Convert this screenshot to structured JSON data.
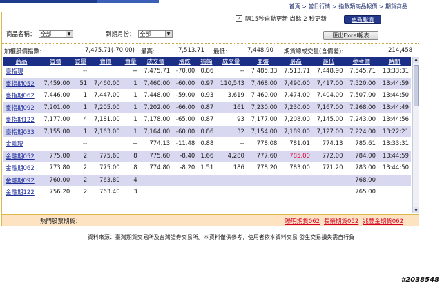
{
  "breadcrumb": [
    "首頁",
    "當日行情",
    "指數類商品報價",
    "期貨商品"
  ],
  "auto_refresh": {
    "label": "隔15秒自動更新 尚餘 2 秒更新",
    "checked": true
  },
  "buttons": {
    "refresh": "更新報價",
    "excel": "匯出Excel報表"
  },
  "filters": {
    "product_label": "商品名稱：",
    "product_value": "全部",
    "month_label": "到期月份：",
    "month_value": "全部"
  },
  "index_row": {
    "label": "加權股價指數:",
    "value": "7,475.71(-70.00)",
    "high_label": "最高:",
    "high": "7,513.71",
    "low_label": "最低:",
    "low": "7,448.90",
    "volume_label": "期貨總成交量(含價差):",
    "volume": "214,458"
  },
  "table": {
    "headers": [
      "商品",
      "買價",
      "買量",
      "賣價",
      "賣量",
      "成交價",
      "漲跌",
      "振幅",
      "成交量",
      "開盤",
      "最高",
      "最低",
      "參考價",
      "時間"
    ],
    "rows": [
      [
        "臺指現",
        "",
        "--",
        "",
        "--",
        "7,475.71",
        "-70.00",
        "0.86",
        "--",
        "7,485.33",
        "7,513.71",
        "7,448.90",
        "7,545.71",
        "13:33:31"
      ],
      [
        "臺指期052",
        "7,459.00",
        "51",
        "7,460.00",
        "1",
        "7,460.00",
        "-60.00",
        "0.97",
        "110,543",
        "7,468.00",
        "7,490.00",
        "7,417.00",
        "7,520.00",
        "13:44:59"
      ],
      [
        "臺指期062",
        "7,446.00",
        "1",
        "7,447.00",
        "1",
        "7,448.00",
        "-59.00",
        "0.93",
        "3,619",
        "7,460.00",
        "7,474.00",
        "7,404.00",
        "7,507.00",
        "13:44:50"
      ],
      [
        "臺指期092",
        "7,201.00",
        "1",
        "7,205.00",
        "1",
        "7,202.00",
        "-66.00",
        "0.87",
        "161",
        "7,230.00",
        "7,230.00",
        "7,167.00",
        "7,268.00",
        "13:44:49"
      ],
      [
        "臺指期122",
        "7,177.00",
        "4",
        "7,181.00",
        "1",
        "7,178.00",
        "-65.00",
        "0.87",
        "93",
        "7,177.00",
        "7,208.00",
        "7,145.00",
        "7,243.00",
        "13:44:56"
      ],
      [
        "臺指期033",
        "7,155.00",
        "1",
        "7,163.00",
        "1",
        "7,164.00",
        "-60.00",
        "0.86",
        "32",
        "7,154.00",
        "7,189.00",
        "7,127.00",
        "7,224.00",
        "13:22:21"
      ],
      [
        "金融現",
        "",
        "--",
        "",
        "--",
        "774.13",
        "-11.48",
        "0.88",
        "--",
        "778.08",
        "781.01",
        "774.13",
        "785.61",
        "13:33:31"
      ],
      [
        "金融期052",
        "775.00",
        "2",
        "775.60",
        "8",
        "775.60",
        "-8.40",
        "1.66",
        "4,280",
        "777.60",
        "785.00",
        "772.00",
        "784.00",
        "13:44:59"
      ],
      [
        "金融期062",
        "773.80",
        "2",
        "775.00",
        "8",
        "774.80",
        "-8.20",
        "1.51",
        "186",
        "778.20",
        "783.00",
        "771.20",
        "783.00",
        "13:44:50"
      ],
      [
        "金融期092",
        "760.00",
        "2",
        "763.80",
        "4",
        "",
        "",
        "",
        "",
        "",
        "",
        "",
        "768.00",
        ""
      ],
      [
        "金融期122",
        "756.20",
        "2",
        "763.40",
        "3",
        "",
        "",
        "",
        "",
        "",
        "",
        "",
        "765.00",
        ""
      ]
    ],
    "red_cell": {
      "row": 7,
      "col": 10
    }
  },
  "hot_futures": {
    "label": "熱門股票期貨：",
    "links": [
      "聯明期貨062",
      "長榮期貨052",
      "兆豐金期貨062"
    ]
  },
  "footer": "資料來源：臺灣期貨交易所及台灣證券交易所。本資料僅供參考，使用者依本資料交易 發生交易損失需自行負",
  "watermark": "#2038548",
  "colors": {
    "header_blue": "#1c2f87",
    "row_alt": "#d8d8f0",
    "hot_bg": "#fde3c2",
    "border_gold": "#d9b94a",
    "link_red": "#d4002a"
  }
}
